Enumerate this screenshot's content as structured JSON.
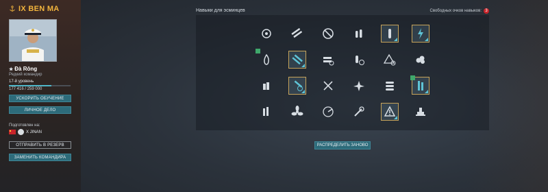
{
  "ship": {
    "title": "IX BEN MA",
    "icon": "anchor-icon"
  },
  "commander": {
    "name": "Đà Rông",
    "rank": "Редкий командир",
    "level": "17-й уровень",
    "xp_text": "177 416 / 259 000",
    "xp_fraction": 0.685
  },
  "buttons": {
    "speed_up": "УСКОРИТЬ ОБУЧЕНИЕ",
    "personal_file": "ЛИЧНОЕ ДЕЛО",
    "to_reserve": "ОТПРАВИТЬ В РЕЗЕРВ",
    "replace": "ЗАМЕНИТЬ КОМАНДИРА",
    "redistribute": "РАСПРЕДЕЛИТЬ ЗАНОВО"
  },
  "trained": {
    "label": "Подготовлен на:",
    "ship": "X JINAN"
  },
  "skills_panel": {
    "heading": "Навыки для эсминцев",
    "free_points_label": "Свободных очков навыков:",
    "free_points": "3"
  },
  "colors": {
    "accent": "#f3b53d",
    "teal": "#2d6b7a",
    "badge": "#c8242a",
    "skill_light": "#d7dde3",
    "skill_cyan": "#5ec3d6"
  },
  "skills": [
    {
      "icon": "gear-target-icon",
      "selected": false
    },
    {
      "icon": "torpedo-tubes-icon",
      "selected": false
    },
    {
      "icon": "prohibited-circle-icon",
      "selected": false
    },
    {
      "icon": "shells-icon",
      "selected": false
    },
    {
      "icon": "shell-upgrade-icon",
      "selected": true
    },
    {
      "icon": "lightning-radar-icon",
      "selected": true
    },
    {
      "icon": "flame-icon",
      "selected": false,
      "new": true
    },
    {
      "icon": "torpedo-reload-icon",
      "selected": true
    },
    {
      "icon": "torpedo-timer-icon",
      "selected": false
    },
    {
      "icon": "ammo-timer-icon",
      "selected": false
    },
    {
      "icon": "warning-timer-icon",
      "selected": false
    },
    {
      "icon": "smoke-icon",
      "selected": false
    },
    {
      "icon": "aa-upgrade-icon",
      "selected": false
    },
    {
      "icon": "torpedo-timer-2-icon",
      "selected": true
    },
    {
      "icon": "crossed-swords-icon",
      "selected": false
    },
    {
      "icon": "plane-target-icon",
      "selected": false
    },
    {
      "icon": "torpedo-stack-icon",
      "selected": false
    },
    {
      "icon": "battery-upgrade-icon",
      "selected": true,
      "new": true
    },
    {
      "icon": "guns-upgrade-icon",
      "selected": false
    },
    {
      "icon": "propeller-icon",
      "selected": false
    },
    {
      "icon": "radar-sweep-icon",
      "selected": false
    },
    {
      "icon": "tools-icon",
      "selected": false
    },
    {
      "icon": "warning-triangle-icon",
      "selected": true
    },
    {
      "icon": "ship-tower-icon",
      "selected": false
    }
  ]
}
